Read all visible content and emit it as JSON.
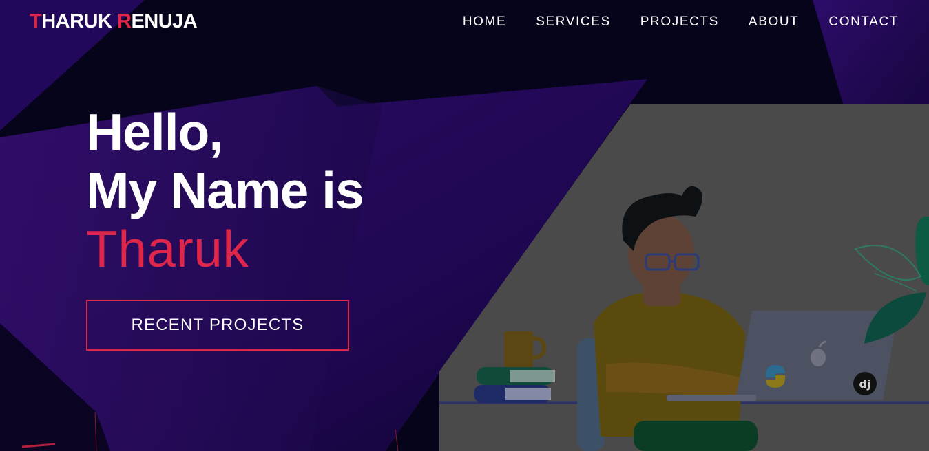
{
  "brand": {
    "first_initial": "T",
    "first_rest": "HARUK ",
    "last_initial": "R",
    "last_rest": "ENUJA",
    "accent_color": "#e0254a"
  },
  "nav": {
    "items": [
      {
        "label": "HOME"
      },
      {
        "label": "SERVICES"
      },
      {
        "label": "PROJECTS"
      },
      {
        "label": "ABOUT"
      },
      {
        "label": "CONTACT"
      }
    ]
  },
  "hero": {
    "line1": "Hello,",
    "line2": "My Name is",
    "name": "Tharuk",
    "cta_label": "RECENT PROJECTS"
  },
  "illustration": {
    "description_icons": [
      "python-logo-icon",
      "django-logo-icon",
      "apple-logo-icon"
    ],
    "django_text": "dj"
  },
  "colors": {
    "background": "#06041a",
    "purple": "#2a0a5c",
    "accent": "#e0254a"
  }
}
